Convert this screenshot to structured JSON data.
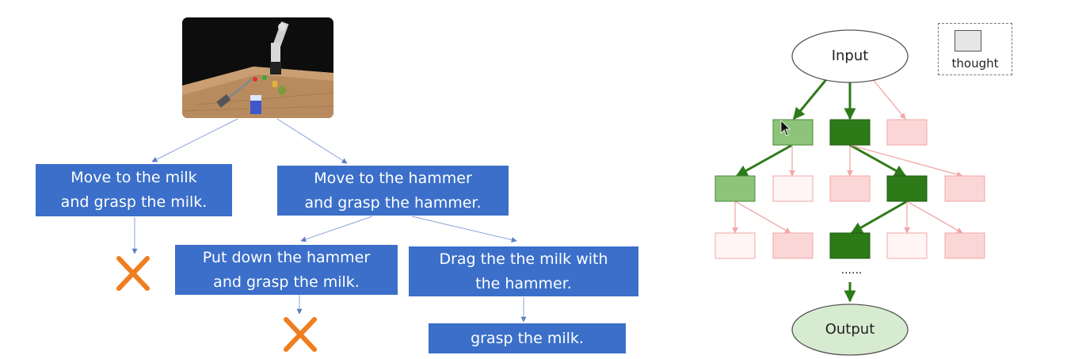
{
  "left_diagram": {
    "root_image": "robot-arm-table-photo",
    "steps": {
      "move_milk": "Move to the milk\nand grasp the milk.",
      "move_hammer": "Move to the hammer\nand grasp the hammer.",
      "put_down": "Put down the hammer\nand grasp the milk.",
      "drag": "Drag the the milk with\nthe hammer.",
      "grasp": "grasp the milk."
    },
    "failure_icon": "x-mark-icon"
  },
  "right_diagram": {
    "input_label": "Input",
    "output_label": "Output",
    "ellipsis": "......",
    "legend_label": "thought"
  },
  "colors": {
    "step_box": "#3b6fc9",
    "arrow_blue": "#6f8fd0",
    "cross": "#f07d1f",
    "green_dark": "#2d7a19",
    "green_light": "#8ec47a",
    "pink_fill": "#fbd6d6",
    "pink_stroke": "#f2a7a7",
    "output_fill": "#d7ebd0"
  },
  "cursor_icon": "mouse-pointer-icon"
}
